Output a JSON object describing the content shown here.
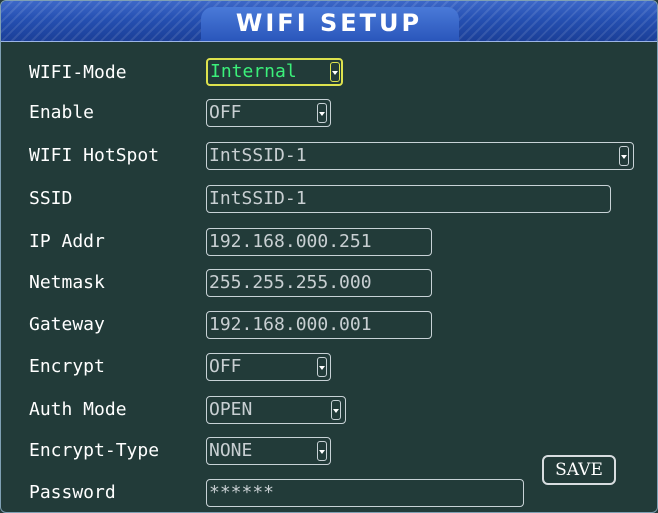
{
  "window": {
    "title": "WIFI SETUP"
  },
  "fields": {
    "wifi_mode": {
      "label": "WIFI-Mode",
      "value": "Internal"
    },
    "enable": {
      "label": "Enable",
      "value": "OFF"
    },
    "hotspot": {
      "label": "WIFI HotSpot",
      "value": "IntSSID-1"
    },
    "ssid": {
      "label": "SSID",
      "value": "IntSSID-1"
    },
    "ip_addr": {
      "label": "IP Addr",
      "value": "192.168.000.251"
    },
    "netmask": {
      "label": "Netmask",
      "value": "255.255.255.000"
    },
    "gateway": {
      "label": "Gateway",
      "value": "192.168.000.001"
    },
    "encrypt": {
      "label": "Encrypt",
      "value": "OFF"
    },
    "auth_mode": {
      "label": "Auth Mode",
      "value": "OPEN"
    },
    "encrypt_type": {
      "label": "Encrypt-Type",
      "value": "NONE"
    },
    "password": {
      "label": "Password",
      "value": "******"
    }
  },
  "buttons": {
    "save": "SAVE"
  },
  "colors": {
    "background": "#223b39",
    "title_bar": "#2550b2",
    "focus_border": "#dde24e",
    "focus_text": "#3bf07a"
  },
  "icons": {
    "dropdown": "dropdown-arrow-icon"
  }
}
